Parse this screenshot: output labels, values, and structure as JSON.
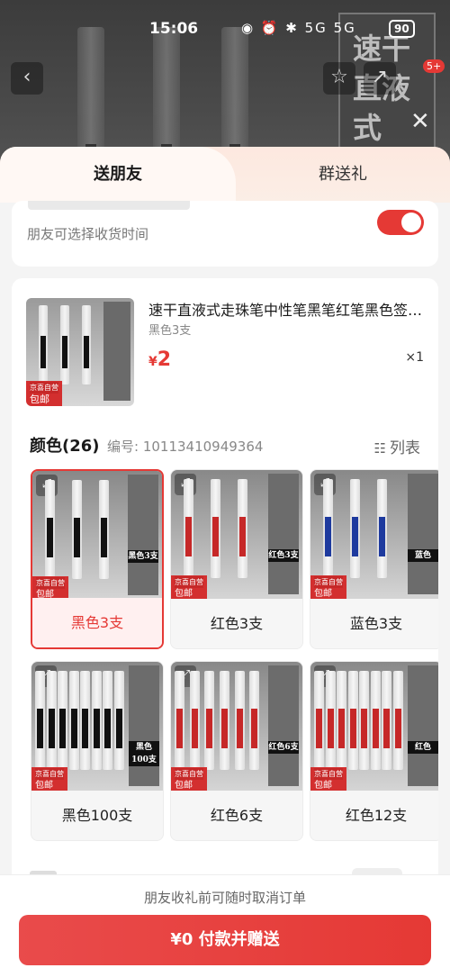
{
  "status_bar": {
    "time": "15:06",
    "icons_text": "◉ ⏰ ✱ 5G 5G",
    "battery": "90"
  },
  "background": {
    "label_text": "速干直液式"
  },
  "header_badge": "5+",
  "tabs": [
    {
      "label": "送朋友"
    },
    {
      "label": "群送礼"
    }
  ],
  "delivery": {
    "hint": "朋友可选择收货时间"
  },
  "product": {
    "title": "速干直液式走珠笔中性笔黑笔红笔黑色签字笔学生用",
    "variant": "黑色3支",
    "price_symbol": "¥",
    "price": "2",
    "quantity": "×1",
    "tag_main": "包邮",
    "tag_top": "京喜自营",
    "thumb_label": "黑色3支"
  },
  "color_section": {
    "title": "颜色(26)",
    "code_label": "编号: 10113410949364",
    "list_label": "列表"
  },
  "options": [
    {
      "name": "黑色3支",
      "ink": "#111111",
      "pens": 3,
      "selected": true,
      "lab": "黑色3支"
    },
    {
      "name": "红色3支",
      "ink": "#c62828",
      "pens": 3,
      "selected": false,
      "lab": "红色3支"
    },
    {
      "name": "蓝色3支",
      "ink": "#1e3a9e",
      "pens": 3,
      "selected": false,
      "lab": "蓝色"
    },
    {
      "name": "黑色100支",
      "ink": "#111111",
      "pens": 8,
      "selected": false,
      "lab": "黑色100支"
    },
    {
      "name": "红色6支",
      "ink": "#c62828",
      "pens": 6,
      "selected": false,
      "lab": "红色6支"
    },
    {
      "name": "红色12支",
      "ink": "#c62828",
      "pens": 8,
      "selected": false,
      "lab": "红色"
    }
  ],
  "footer": {
    "note": "朋友收礼前可随时取消订单",
    "pay_label": "¥0 付款并赠送"
  },
  "colors": {
    "accent": "#e53935"
  }
}
